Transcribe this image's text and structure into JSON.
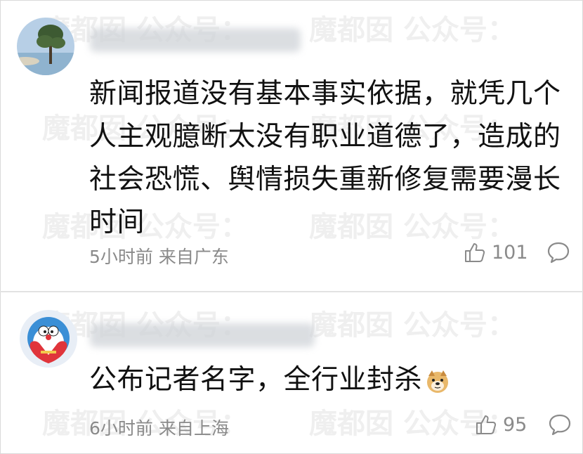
{
  "watermark": "魔都囡  公众号：",
  "comments": [
    {
      "text": "新闻报道没有基本事实依据，就凭几个人主观臆断太没有职业道德了，造成的社会恐慌、舆情损失重新修复需要漫长时间",
      "meta": "5小时前 来自广东",
      "likes": "101"
    },
    {
      "text": "公布记者名字，全行业封杀",
      "meta": "6小时前 来自上海",
      "likes": "95",
      "emoji": "doge-emoji"
    }
  ],
  "icons": {
    "like": "thumbs-up-icon",
    "reply": "comment-bubble-icon"
  }
}
